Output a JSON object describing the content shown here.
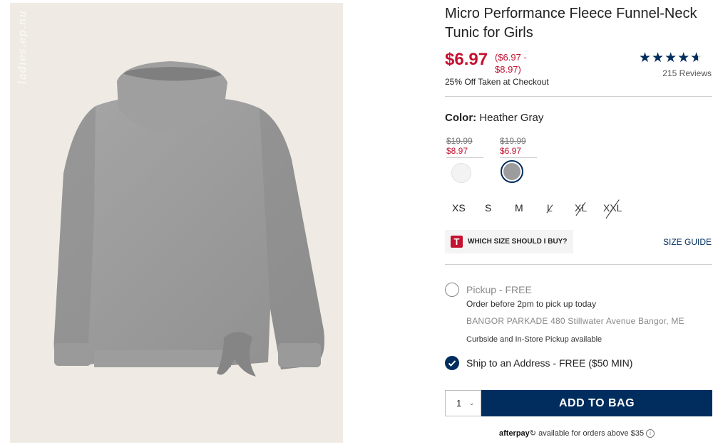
{
  "watermark": "ladies.ep.nu",
  "product": {
    "title": "Micro Performance Fleece Funnel-Neck Tunic for Girls",
    "price": "$6.97",
    "price_range": "($6.97 - $8.97)",
    "discount_note": "25% Off Taken at Checkout",
    "rating_stars": "★★★★★",
    "rating_value": 4.5,
    "reviews": "215 Reviews"
  },
  "color": {
    "label": "Color:",
    "selected": "Heather Gray",
    "swatches": [
      {
        "orig_price": "$19.99",
        "sale_price": "$8.97",
        "hex": "#f2f2f2"
      },
      {
        "orig_price": "$19.99",
        "sale_price": "$6.97",
        "hex": "#9c9c9c"
      }
    ]
  },
  "sizes": [
    {
      "label": "XS",
      "available": true
    },
    {
      "label": "S",
      "available": true
    },
    {
      "label": "M",
      "available": true
    },
    {
      "label": "L",
      "available": false
    },
    {
      "label": "XL",
      "available": false
    },
    {
      "label": "XXL",
      "available": false
    }
  ],
  "size_help": {
    "label": "WHICH SIZE SHOULD I BUY?",
    "icon_letter": "T",
    "guide": "SIZE GUIDE"
  },
  "fulfillment": {
    "pickup_label": "Pickup - FREE",
    "pickup_note": "Order before 2pm to pick up today",
    "store": "BANGOR PARKADE 480 Stillwater Avenue  Bangor, ME",
    "curbside": "Curbside and In-Store Pickup available",
    "ship_label": "Ship to an Address - FREE ($50 MIN)"
  },
  "cart": {
    "quantity": "1",
    "add_label": "ADD TO BAG"
  },
  "afterpay": {
    "brand": "afterpay",
    "text": "available for orders above $35"
  },
  "colors": {
    "brand_navy": "#002d5e",
    "sale_red": "#c41230"
  }
}
